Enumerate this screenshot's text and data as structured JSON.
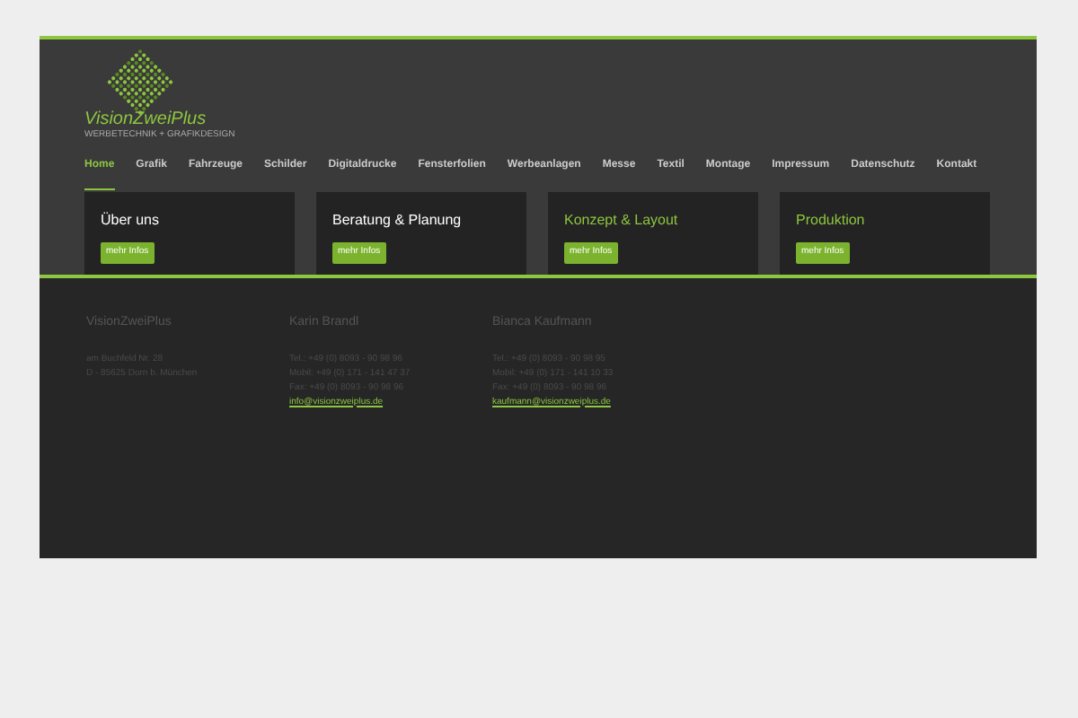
{
  "logo": {
    "name": "VisionZweiPlus",
    "tagline": "WERBETECHNIK + GRAFIKDESIGN"
  },
  "nav": [
    {
      "label": "Home",
      "selected": true
    },
    {
      "label": "Grafik",
      "selected": false
    },
    {
      "label": "Fahrzeuge",
      "selected": false
    },
    {
      "label": "Schilder",
      "selected": false
    },
    {
      "label": "Digitaldrucke",
      "selected": false
    },
    {
      "label": "Fensterfolien",
      "selected": false
    },
    {
      "label": "Werbeanlagen",
      "selected": false
    },
    {
      "label": "Messe",
      "selected": false
    },
    {
      "label": "Textil",
      "selected": false
    },
    {
      "label": "Montage",
      "selected": false
    },
    {
      "label": "Impressum",
      "selected": false
    },
    {
      "label": "Datenschutz",
      "selected": false
    },
    {
      "label": "Kontakt",
      "selected": false
    }
  ],
  "cards": [
    {
      "title": "Über uns",
      "highlighted": false,
      "button": "mehr Infos"
    },
    {
      "title": "Beratung & Planung",
      "highlighted": false,
      "button": "mehr Infos"
    },
    {
      "title": "Konzept & Layout",
      "highlighted": true,
      "button": "mehr Infos"
    },
    {
      "title": "Produktion",
      "highlighted": true,
      "button": "mehr Infos"
    }
  ],
  "footer": [
    {
      "heading": "VisionZweiPlus",
      "lines": [
        "am Buchfeld Nr. 28",
        "D - 85625 Dorn b. München"
      ]
    },
    {
      "heading": "Karin Brandl",
      "lines": [
        "Tel.: +49 (0) 8093 - 90 98 96",
        "Mobil: +49 (0) 171 - 141 47 37",
        "Fax: +49 (0) 8093 - 90 98 96"
      ],
      "email": "info@visionzweiplus.de"
    },
    {
      "heading": "Bianca Kaufmann",
      "lines": [
        "Tel.: +49 (0) 8093 - 90 98 95",
        "Mobil: +49 (0) 171 - 141 10 33",
        "Fax: +49 (0) 8093 - 90 98 96"
      ],
      "email": "kaufmann@visionzweiplus.de"
    }
  ]
}
